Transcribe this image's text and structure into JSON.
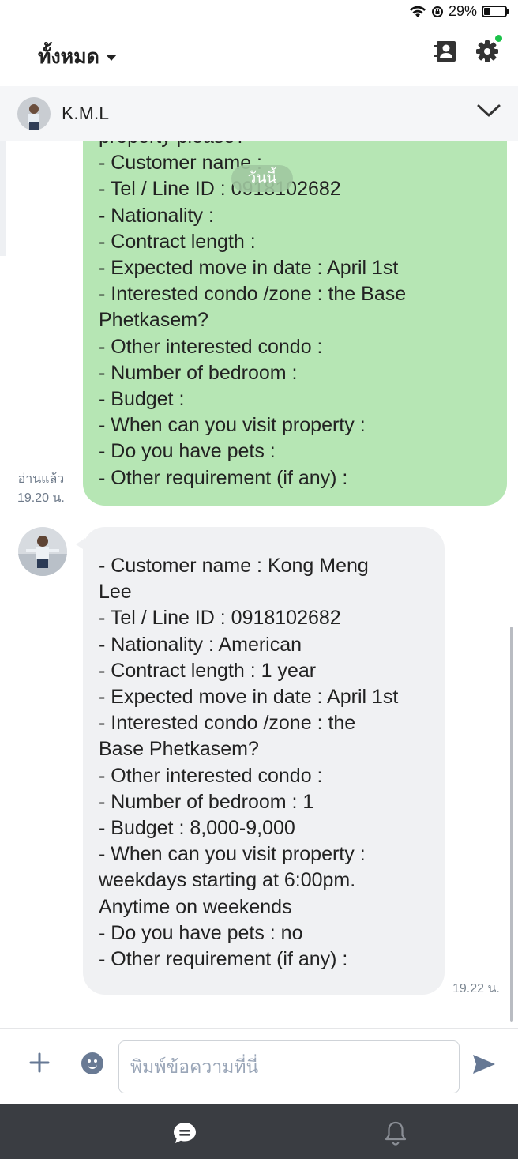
{
  "status_bar": {
    "battery": "29%"
  },
  "header": {
    "filter_label": "ทั้งหมด"
  },
  "chat": {
    "contact_name": "K.M.L",
    "date_divider": "วันนี้",
    "outgoing": {
      "lines": [
        "property please?",
        "- Customer name :",
        "- Tel / Line ID : 0918102682",
        "- Nationality :",
        "- Contract length :",
        "- Expected move in date : April 1st",
        "- Interested condo /zone : the Base",
        "Phetkasem?",
        "- Other interested condo :",
        "- Number of bedroom  :",
        "- Budget :",
        "- When can you visit property :",
        "- Do you have pets :",
        "- Other requirement (if any) :"
      ],
      "read_label": "อ่านแล้ว",
      "time": "19.20 น."
    },
    "incoming": {
      "lines": [
        "",
        "- Customer name : Kong Meng",
        "Lee",
        "- Tel / Line ID : 0918102682",
        "- Nationality : American",
        "- Contract length : 1 year",
        "- Expected move in date : April 1st",
        "- Interested condo /zone : the",
        "Base Phetkasem?",
        "- Other interested condo :",
        "- Number of bedroom  :  1",
        "- Budget : 8,000-9,000",
        "- When can you visit property :",
        "weekdays starting at 6:00pm.",
        "Anytime on weekends",
        "- Do you have pets : no",
        "- Other requirement (if any) :"
      ],
      "time": "19.22 น."
    }
  },
  "composer": {
    "placeholder": "พิมพ์ข้อความที่นี่"
  },
  "colors": {
    "outgoing_bubble": "#b6e6b4",
    "incoming_bubble": "#f0f1f3",
    "bottom_nav": "#3a3d42",
    "online_dot": "#1cc24a"
  }
}
